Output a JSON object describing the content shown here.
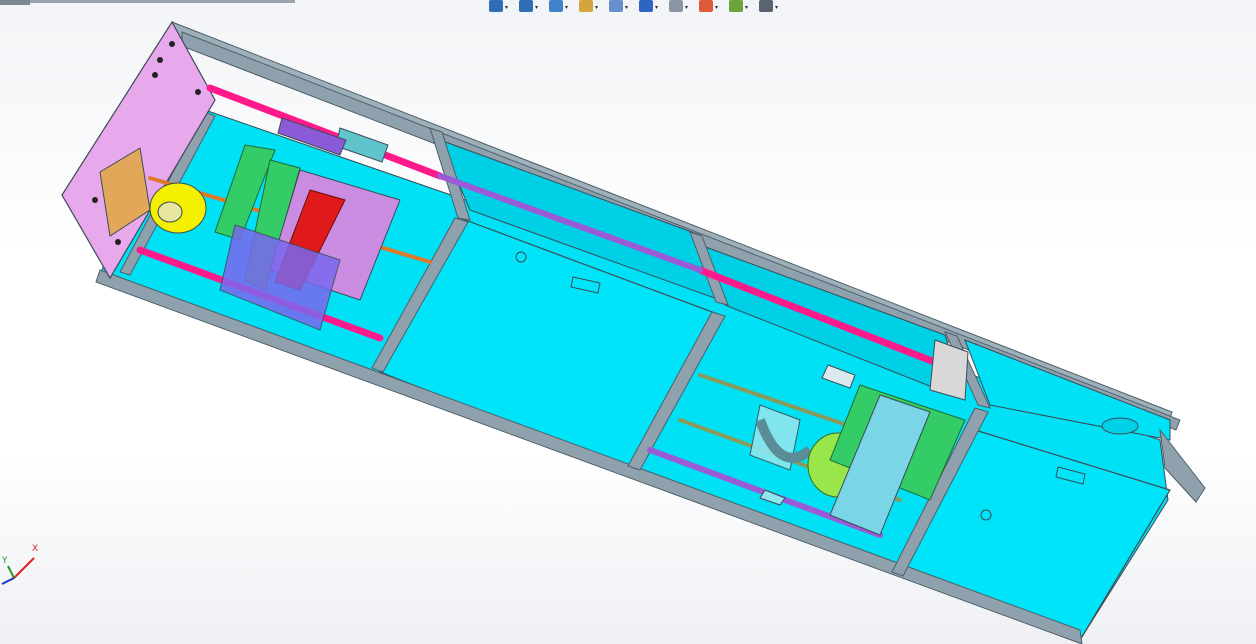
{
  "app": {
    "window_title": ""
  },
  "toolbar": {
    "items": [
      {
        "name": "zoom-to-fit",
        "icon": "magnify-fit-icon",
        "color": "#2f6db5"
      },
      {
        "name": "zoom-to-area",
        "icon": "magnify-area-icon",
        "color": "#2f6db5"
      },
      {
        "name": "previous-view",
        "icon": "previous-view-icon",
        "color": "#3f82c9"
      },
      {
        "name": "section-view",
        "icon": "section-view-icon",
        "color": "#d3a53c"
      },
      {
        "name": "view-orientation",
        "icon": "view-orientation-icon",
        "color": "#6a8fd0"
      },
      {
        "name": "display-style",
        "icon": "display-style-icon",
        "color": "#2c66c2"
      },
      {
        "name": "hide-show-items",
        "icon": "hide-show-icon",
        "color": "#8a96a6"
      },
      {
        "name": "edit-appearance",
        "icon": "appearance-icon",
        "color": "#e05a3a"
      },
      {
        "name": "apply-scene",
        "icon": "scene-icon",
        "color": "#6aa43a"
      },
      {
        "name": "view-settings",
        "icon": "monitor-icon",
        "color": "#5a6470"
      }
    ]
  },
  "triad": {
    "x_label": "X",
    "y_label": "Y",
    "x_color": "#d22",
    "y_color": "#2a9a2a",
    "z_color": "#2233cc"
  },
  "colors": {
    "frame": "#8fa1ad",
    "frame_dark": "#5d6e78",
    "panel": "#00e1f6",
    "end_plate": "#e6a6e6",
    "rod": "#ff1a8c",
    "rod_purple": "#9b5ad6",
    "bracket_green": "#33cc66",
    "bracket_red": "#e01a1a",
    "gear_yellow": "#f5f000",
    "plate_purple": "#7b68ee"
  }
}
